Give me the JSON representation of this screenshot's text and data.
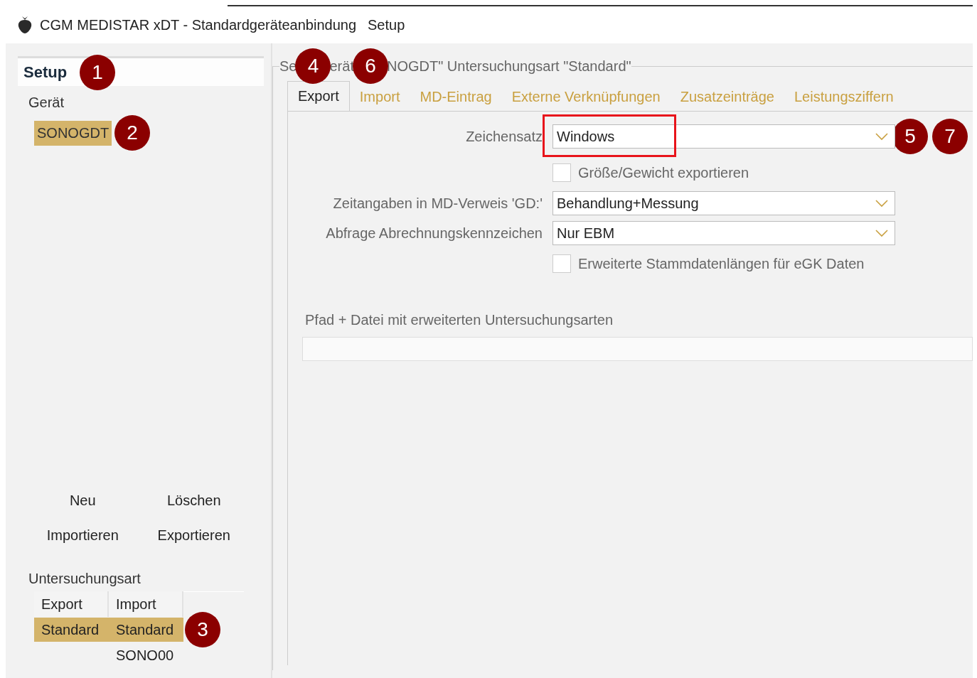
{
  "window": {
    "title": "CGM MEDISTAR xDT - Standardgeräteanbindung",
    "menu": "Setup"
  },
  "sidebar": {
    "header": "Setup",
    "header_marker": "1",
    "device_label": "Gerät",
    "devices": [
      {
        "name": "SONOGDT",
        "selected": true,
        "marker": "2"
      }
    ],
    "buttons": [
      {
        "label": "Neu"
      },
      {
        "label": "Löschen"
      },
      {
        "label": "Importieren"
      },
      {
        "label": "Exportieren"
      }
    ],
    "exam_label": "Untersuchungsart",
    "exam_columns": [
      "Export",
      "Import"
    ],
    "exam_rows": [
      {
        "export": "Standard",
        "import": "Standard",
        "selected": true,
        "marker": "3"
      },
      {
        "import": "SONO00",
        "selected": false
      }
    ]
  },
  "settings": {
    "title_parts": [
      {
        "kind": "text",
        "text": "Se"
      },
      {
        "kind": "marker",
        "text": "4"
      },
      {
        "kind": "text",
        "text": "erät"
      },
      {
        "kind": "marker",
        "text": "6"
      },
      {
        "kind": "text",
        "text": "NOGDT\" Untersuchungsart \"Standard\""
      }
    ],
    "tabs": [
      {
        "label": "Export",
        "selected": true
      },
      {
        "label": "Import",
        "selected": false
      },
      {
        "label": "MD-Eintrag",
        "selected": false
      },
      {
        "label": "Externe Verknüpfungen",
        "selected": false
      },
      {
        "label": "Zusatzeinträge",
        "selected": false
      },
      {
        "label": "Leistungsziffern",
        "selected": false
      }
    ],
    "fields": [
      {
        "kind": "select",
        "label": "Zeichensatz",
        "value": "Windows",
        "highlighted": true,
        "markers": [
          "5",
          "7"
        ]
      },
      {
        "kind": "checkbox",
        "label": "Größe/Gewicht exportieren",
        "checked": false
      },
      {
        "kind": "select",
        "label": "Zeitangaben in MD-Verweis 'GD:'",
        "value": "Behandlung+Messung",
        "highlighted": false
      },
      {
        "kind": "select",
        "label": "Abfrage Abrechnungskennzeichen",
        "value": "Nur EBM",
        "highlighted": false
      },
      {
        "kind": "checkbox",
        "label": "Erweiterte Stammdatenlängen für eGK Daten",
        "checked": false
      }
    ],
    "path_label": "Pfad + Datei mit erweiterten Untersuchungsarten"
  }
}
